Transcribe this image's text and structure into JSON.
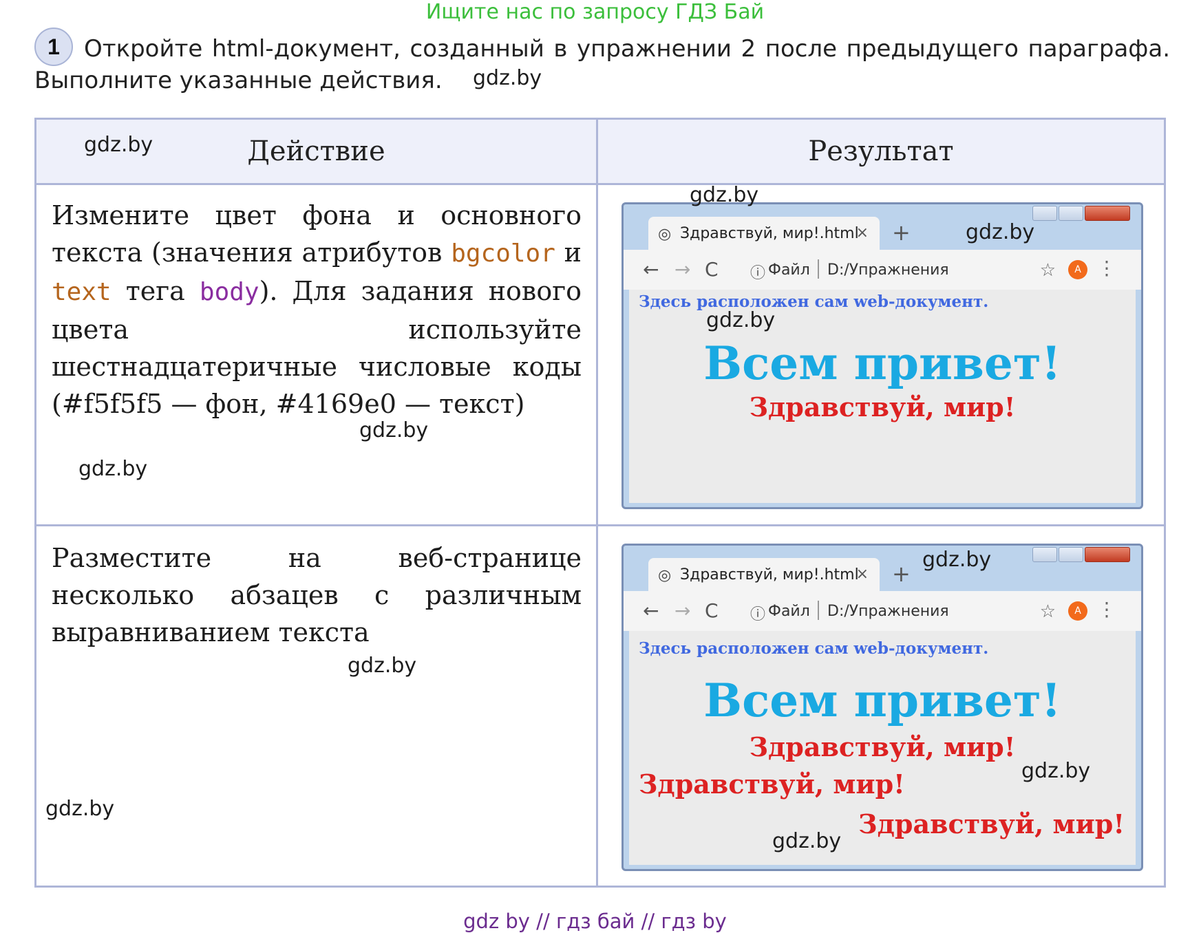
{
  "banner": "Ищите нас по запросу ГДЗ Бай",
  "task": {
    "number": "1",
    "text": "Откройте html-документ, созданный в упражнении 2 после предыдущего параграфа. Выполните указанные действия."
  },
  "watermark": "gdz.by",
  "table": {
    "header_action": "Действие",
    "header_result": "Результат",
    "row1": {
      "t1": "Измените цвет фона и основного текста (значения атрибутов ",
      "kw_bgcolor": "bgcolor",
      "t2": " и ",
      "kw_text": "text",
      "t3": " тега ",
      "kw_body": "body",
      "t4": "). Для задания нового цвета используйте шестнадцатеричные числовые коды (#f5f5f5 — фон, #4169e0 — текст)"
    },
    "row2": {
      "text": "Разместите на веб-странице несколько абзацев с различным выравниванием текста"
    }
  },
  "browser": {
    "tab_title": "Здравствуй, мир!.html",
    "tab_close": "×",
    "new_tab": "+",
    "back": "←",
    "forward": "→",
    "reload": "C",
    "scheme": "Файл",
    "path": "D:/Упражнения",
    "star": "☆",
    "avatar_letter": "A",
    "menu": "⋮",
    "intro": "Здесь расположен сам web-документ.",
    "hello": "Всем привет!",
    "world": "Здравствуй, мир!"
  },
  "footer": "gdz by  //  гдз бай  //  гдз by",
  "colors": {
    "accent_bgcolor": "#b5651d",
    "accent_body": "#8a2da0",
    "page_text": "#4169e0",
    "hello": "#1aa9e2",
    "world": "#dd2222"
  }
}
